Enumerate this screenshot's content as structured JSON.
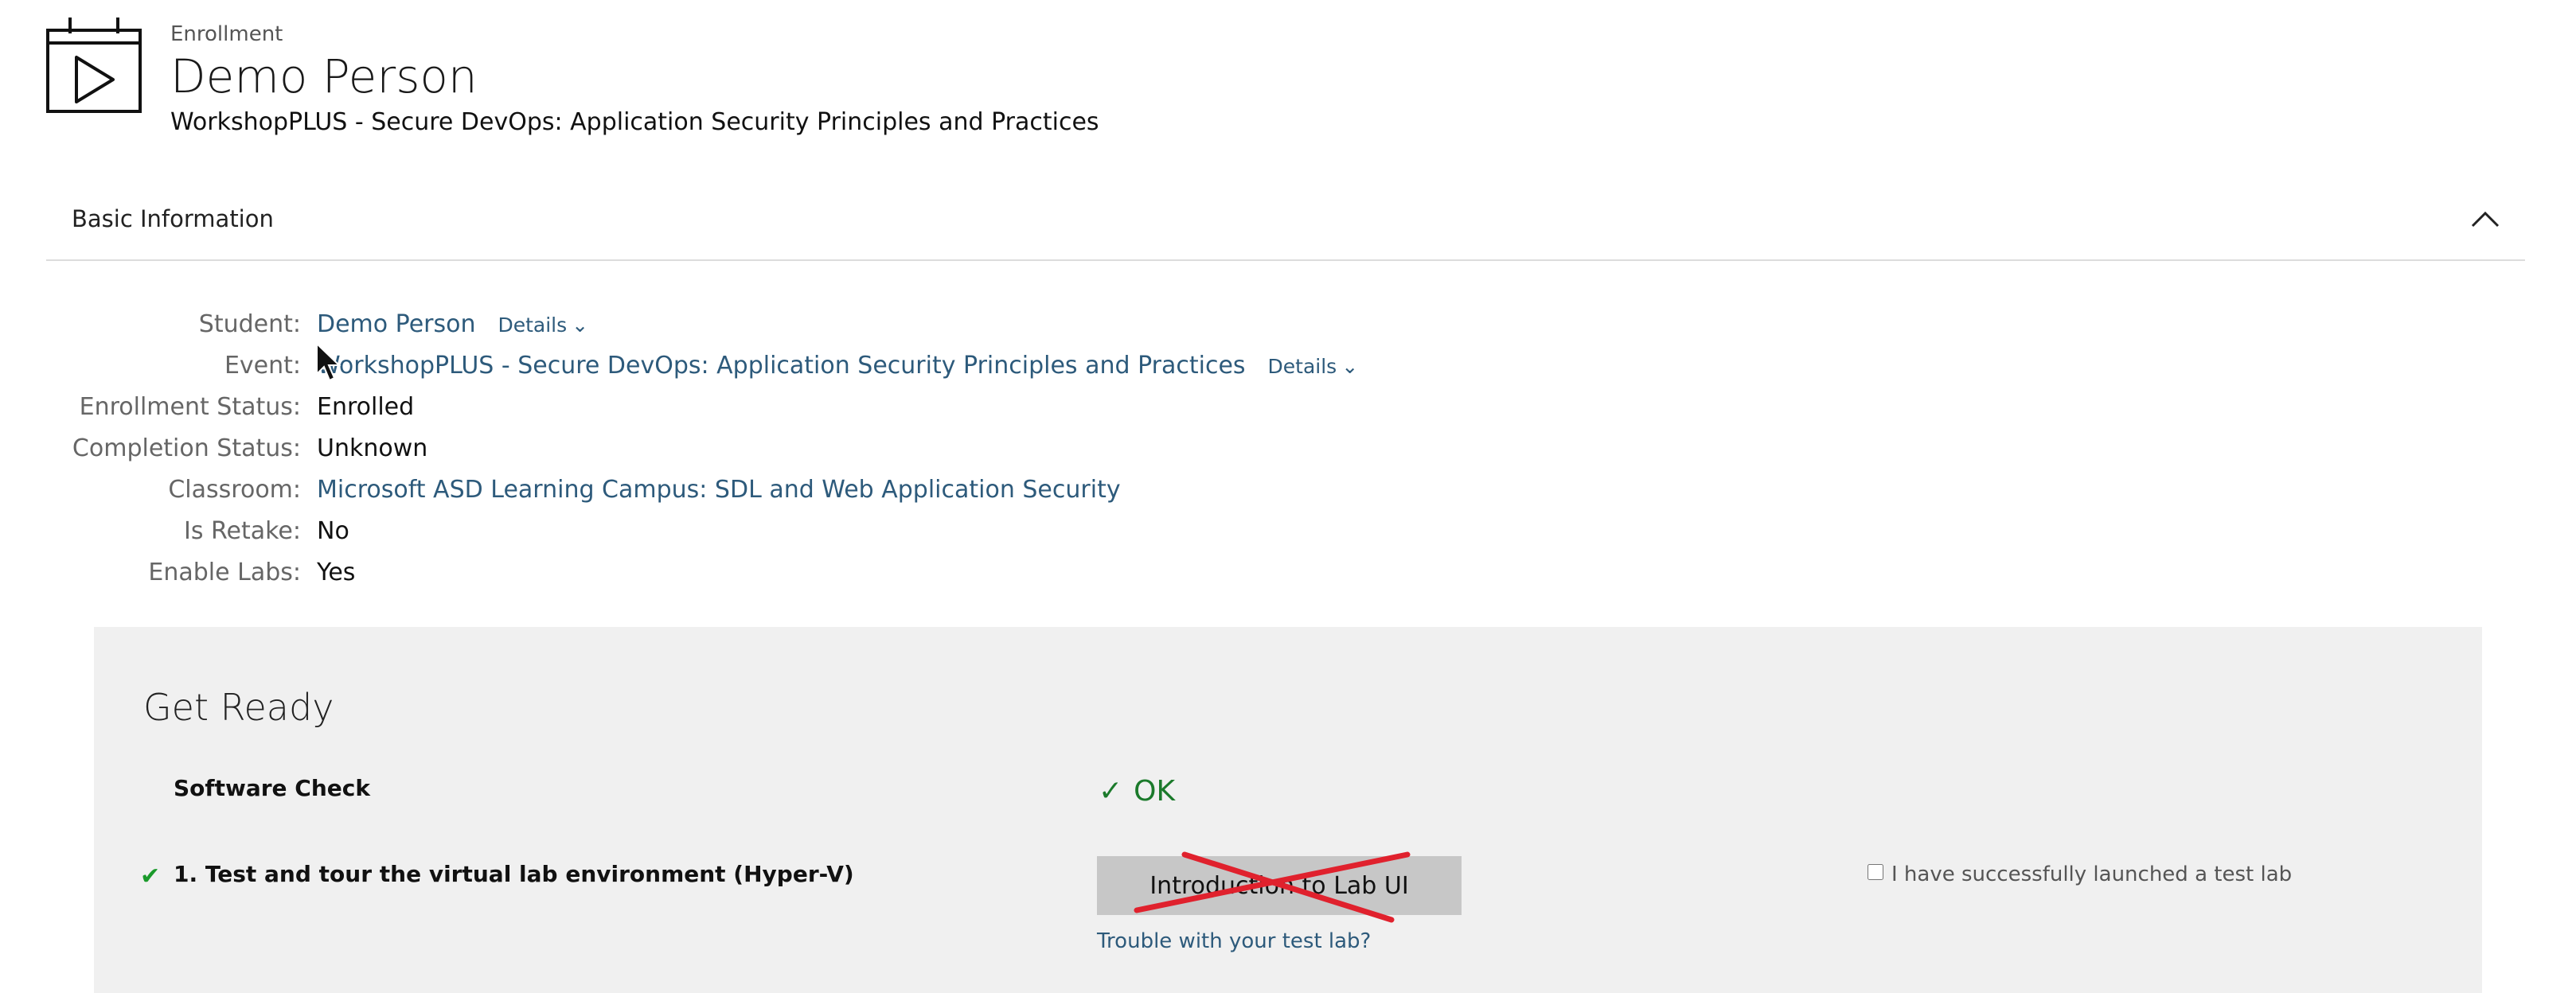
{
  "header": {
    "eyebrow": "Enrollment",
    "title": "Demo Person",
    "subtitle": "WorkshopPLUS - Secure DevOps: Application Security Principles and Practices",
    "icon": "enrollment-play-icon"
  },
  "basic_info": {
    "title": "Basic Information",
    "collapse_icon": "chevron-up-icon",
    "details_label": "Details",
    "fields": {
      "student": {
        "label": "Student:",
        "value": "Demo Person"
      },
      "event": {
        "label": "Event:",
        "value": "WorkshopPLUS - Secure DevOps: Application Security Principles and Practices"
      },
      "enrollment_status": {
        "label": "Enrollment Status:",
        "value": "Enrolled"
      },
      "completion_status": {
        "label": "Completion Status:",
        "value": "Unknown"
      },
      "classroom": {
        "label": "Classroom:",
        "value": "Microsoft ASD Learning Campus: SDL and Web Application Security"
      },
      "is_retake": {
        "label": "Is Retake:",
        "value": "No"
      },
      "enable_labs": {
        "label": "Enable Labs:",
        "value": "Yes"
      }
    }
  },
  "get_ready": {
    "title": "Get Ready",
    "software_check": {
      "label": "Software Check",
      "status": "OK",
      "status_color": "#1b7a2b"
    },
    "task": {
      "label": "1. Test and tour the virtual lab environment (Hyper-V)",
      "button_label": "Introduction to Lab UI",
      "trouble_link": "Trouble with your test lab?",
      "checkbox_label": "I have successfully launched a test lab",
      "checkbox_checked": false
    }
  },
  "colors": {
    "link": "#2d5a7b",
    "panel_bg": "#f0f0f0",
    "strike": "#e0212d"
  }
}
